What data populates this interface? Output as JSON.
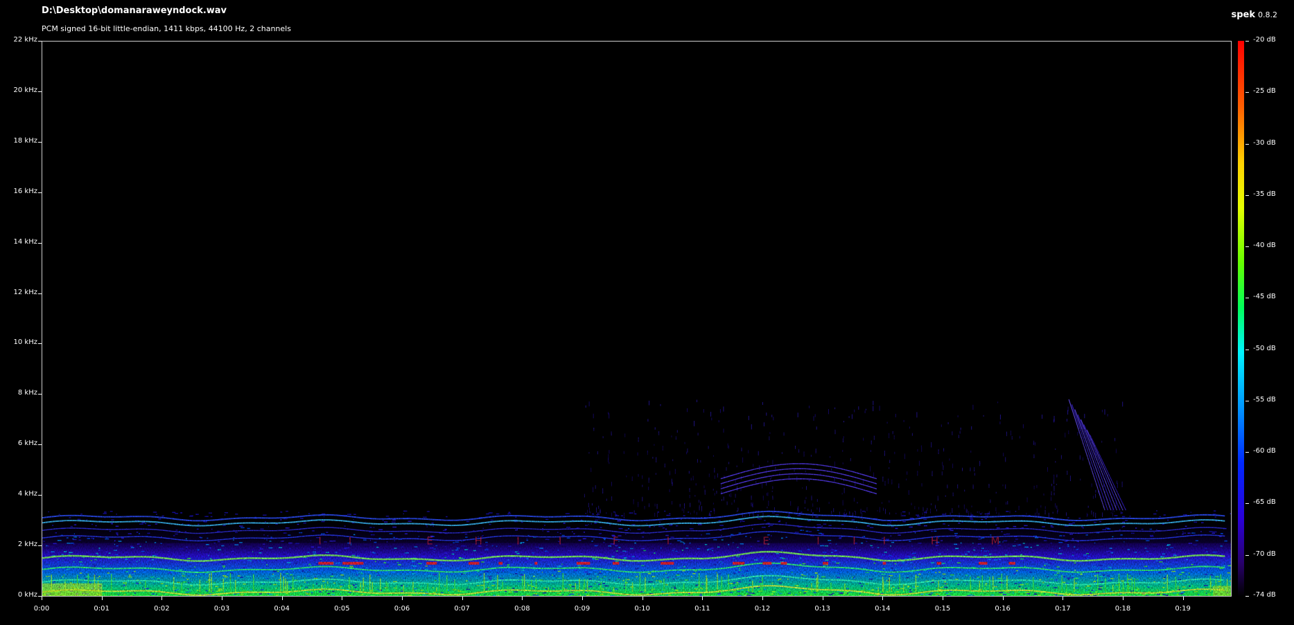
{
  "header": {
    "file_path": "D:\\Desktop\\domanaraweyndock.wav",
    "file_info": "PCM signed 16-bit little-endian, 1411 kbps, 44100 Hz, 2 channels"
  },
  "app": {
    "name": "spek",
    "version": "0.8.2"
  },
  "spectrogram": {
    "frequency_labels": [
      "22 kHz",
      "20 kHz",
      "18 kHz",
      "16 kHz",
      "14 kHz",
      "12 kHz",
      "10 kHz",
      "8 kHz",
      "6 kHz",
      "4 kHz",
      "2 kHz",
      "0 kHz"
    ],
    "time_labels": [
      "0:00",
      "0:01",
      "0:02",
      "0:03",
      "0:04",
      "0:05",
      "0:06",
      "0:07",
      "0:08",
      "0:09",
      "0:10",
      "0:11",
      "0:12",
      "0:13",
      "0:14",
      "0:15",
      "0:16",
      "0:17",
      "0:18",
      "0:19"
    ],
    "frequency_range_khz": [
      0,
      22
    ],
    "duration_seconds": 19.8,
    "hidden_letters": [
      "I",
      "I",
      "E",
      "H",
      "I",
      "I",
      "F",
      "I",
      "E",
      "I",
      "I",
      "I",
      "H",
      "M"
    ]
  },
  "colorbar": {
    "labels": [
      "-20 dB",
      "-25 dB",
      "-30 dB",
      "-35 dB",
      "-40 dB",
      "-45 dB",
      "-50 dB",
      "-55 dB",
      "-60 dB",
      "-65 dB",
      "-70 dB",
      "-74 dB"
    ],
    "range_db": [
      -74,
      -20
    ]
  },
  "colors": {
    "background": "#000000",
    "text": "#ffffff",
    "high": "#ff0000",
    "mid": "#00ff5a",
    "low": "#0028ff"
  }
}
